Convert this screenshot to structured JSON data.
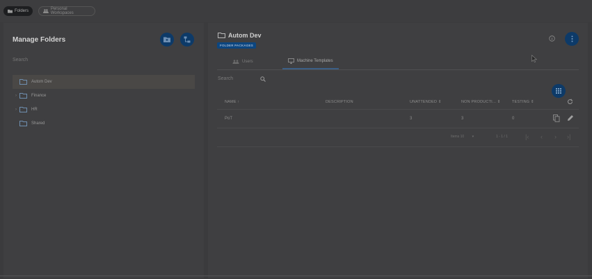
{
  "topbar": {
    "folders_chip": "Folders",
    "personal_chip": "Personal Workspaces"
  },
  "left": {
    "title": "Manage Folders",
    "search_label": "Search",
    "folders": [
      {
        "label": "Autom Dev",
        "selected": true,
        "expandable": false
      },
      {
        "label": "Finance",
        "selected": false,
        "expandable": true
      },
      {
        "label": "HR",
        "selected": false,
        "expandable": true
      },
      {
        "label": "Shared",
        "selected": false,
        "expandable": false
      }
    ]
  },
  "right": {
    "folder_name": "Autom Dev",
    "badge": "FOLDER PACKAGES",
    "tabs": [
      {
        "label": "Users",
        "active": false
      },
      {
        "label": "Machine Templates",
        "active": true
      }
    ],
    "search_label": "Search",
    "columns": [
      "NAME",
      "DESCRIPTION",
      "UNATTENDED",
      "NON PRODUCTI...",
      "TESTING"
    ],
    "rows": [
      {
        "name": "PoT",
        "description": "",
        "unattended": "3",
        "nonproduction": "3",
        "testing": "0"
      }
    ],
    "pager": {
      "items_label": "Items 10",
      "range": "1 - 1 / 1"
    }
  },
  "colors": {
    "background": "#3b3b3d",
    "panel": "#3f3f41",
    "accent": "#0d3a68"
  }
}
